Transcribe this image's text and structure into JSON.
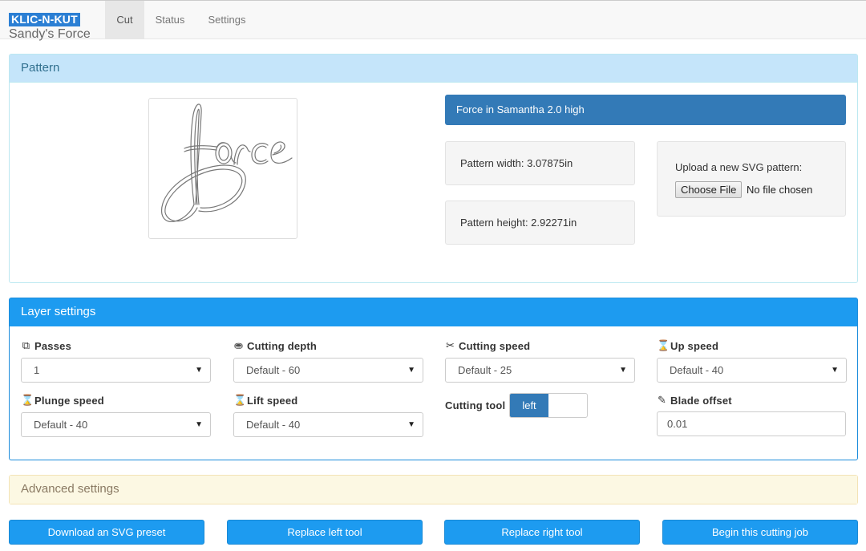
{
  "nav": {
    "brand_logo": "KLIC-N-KUT",
    "brand_subtitle": "Sandy's Force",
    "tabs": [
      {
        "label": "Cut",
        "active": true
      },
      {
        "label": "Status",
        "active": false
      },
      {
        "label": "Settings",
        "active": false
      }
    ]
  },
  "pattern": {
    "heading": "Pattern",
    "thumbnail_icon": "force-script-pattern",
    "name": "Force in Samantha 2.0 high",
    "width_text": "Pattern width: 3.07875in",
    "height_text": "Pattern height: 2.92271in",
    "upload_label": "Upload a new SVG pattern:",
    "file_button": "Choose File",
    "file_status": "No file chosen"
  },
  "layer": {
    "heading": "Layer settings",
    "passes": {
      "label": "Passes",
      "value": "1",
      "icon": "copy-icon"
    },
    "cutting_depth": {
      "label": "Cutting depth",
      "value": "Default - 60",
      "icon": "cylinder-icon"
    },
    "cutting_speed": {
      "label": "Cutting speed",
      "value": "Default - 25",
      "icon": "scissors-icon"
    },
    "up_speed": {
      "label": "Up speed",
      "value": "Default - 40",
      "icon": "hourglass-icon"
    },
    "plunge_speed": {
      "label": "Plunge speed",
      "value": "Default - 40",
      "icon": "hourglass-icon"
    },
    "lift_speed": {
      "label": "Lift speed",
      "value": "Default - 40",
      "icon": "hourglass-icon"
    },
    "cutting_tool": {
      "label": "Cutting tool",
      "value": "left"
    },
    "blade_offset": {
      "label": "Blade offset",
      "value": "0.01",
      "icon": "edit-icon"
    }
  },
  "advanced": {
    "heading": "Advanced settings"
  },
  "buttons": {
    "download": "Download an SVG preset",
    "replace_left": "Replace left tool",
    "replace_right": "Replace right tool",
    "begin": "Begin this cutting job"
  },
  "colors": {
    "primary_blue": "#1d9bf0",
    "dark_blue": "#337ab7",
    "info_heading_bg": "#c5e5fa",
    "warning_heading_bg": "#fcf8e3"
  }
}
